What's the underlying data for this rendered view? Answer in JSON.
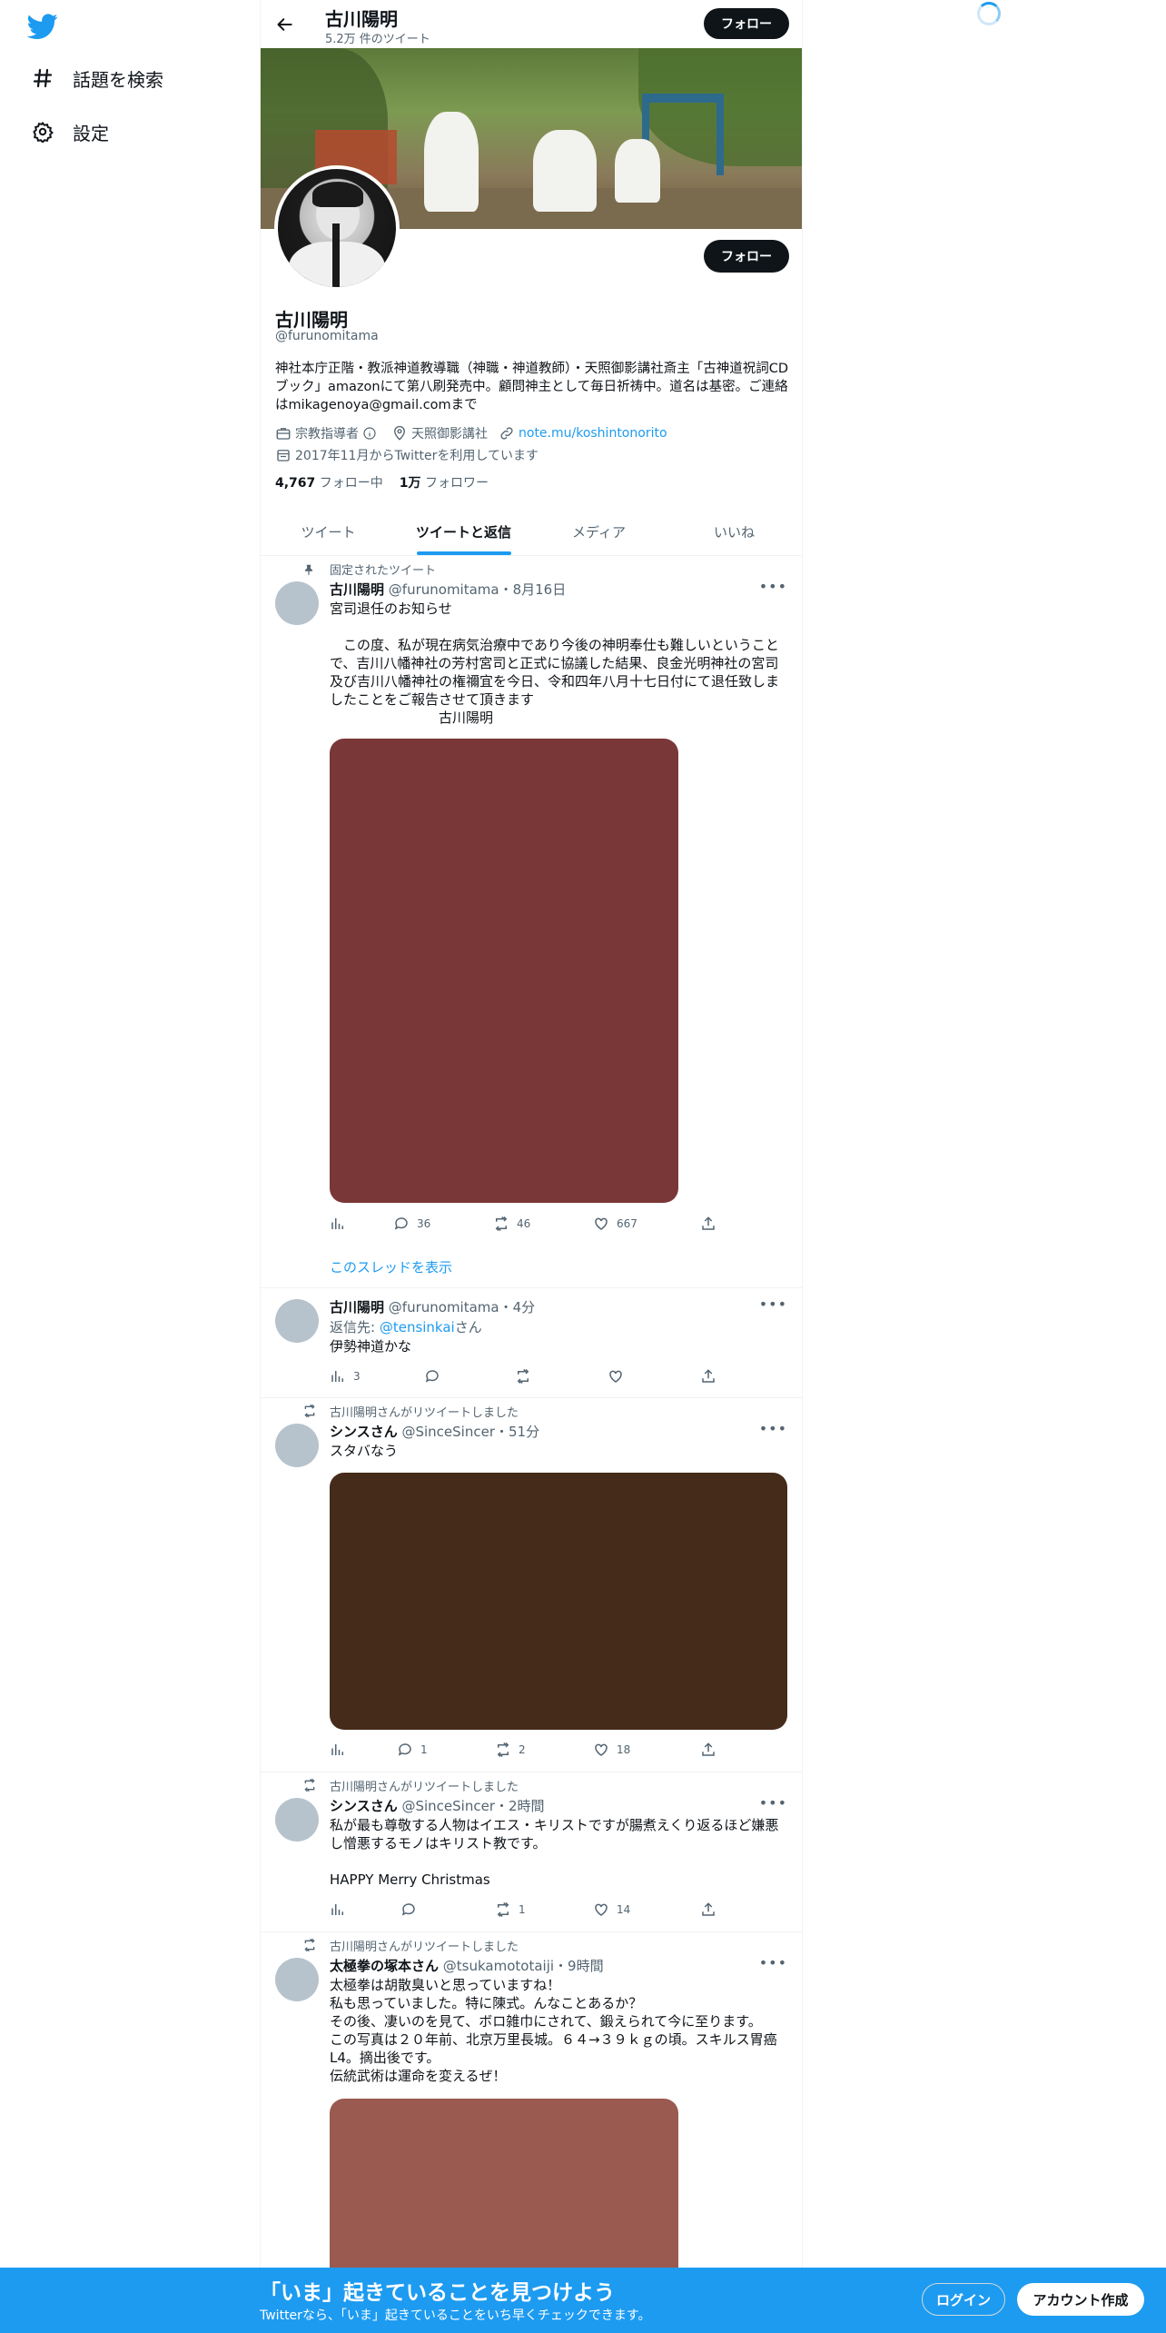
{
  "nav": {
    "explore_label": "話題を検索",
    "settings_label": "設定"
  },
  "header": {
    "name": "古川陽明",
    "tweet_count": "5.2万 件のツイート",
    "follow_label": "フォロー"
  },
  "profile": {
    "name": "古川陽明",
    "handle": "@furunomitama",
    "follow_label": "フォロー",
    "bio": "神社本庁正階・教派神道教導職（神職・神道教師）・天照御影講社斎主「古神道祝詞CDブック」amazonにて第八刷発売中。顧問神主として毎日祈祷中。道名は基密。ご連絡はmikagenoya@gmail.comまで",
    "category": "宗教指導者",
    "location": "天照御影講社",
    "url": "note.mu/koshintonorito",
    "joined": "2017年11月からTwitterを利用しています",
    "following_count": "4,767",
    "following_label": "フォロー中",
    "followers_count": "1万",
    "followers_label": "フォロワー"
  },
  "tabs": [
    {
      "label": "ツイート"
    },
    {
      "label": "ツイートと返信"
    },
    {
      "label": "メディア"
    },
    {
      "label": "いいね"
    }
  ],
  "tweets": [
    {
      "context": "固定されたツイート",
      "name": "古川陽明",
      "meta": "@furunomitama・8月16日",
      "text": "宮司退任のお知らせ\n\n　この度、私が現在病気治療中であり今後の神明奉仕も難しいということで、吉川八幡神社の芳村宮司と正式に協議した結果、良金光明神社の宮司及び吉川八幡神社の権禰宜を今日、令和四年八月十七日付にて退任致しましたことをご報告させて頂きます\n　　　　　　　　古川陽明",
      "image_color": "#7a3737",
      "views": "",
      "replies": "36",
      "retweets": "46",
      "likes": "667",
      "show_thread": "このスレッドを表示"
    },
    {
      "name": "古川陽明",
      "meta": "@furunomitama・4分",
      "reply_prefix": "返信先: ",
      "reply_to": "@tensinkai",
      "reply_suffix": "さん",
      "text": "伊勢神道かな",
      "views": "3",
      "replies": "",
      "retweets": "",
      "likes": ""
    },
    {
      "context": "古川陽明さんがリツイートしました",
      "name": "シンスさん",
      "meta": "@SinceSincer・51分",
      "text": "スタバなう",
      "image_color": "#452b1a",
      "views": "",
      "replies": "1",
      "retweets": "2",
      "likes": "18"
    },
    {
      "context": "古川陽明さんがリツイートしました",
      "name": "シンスさん",
      "meta": "@SinceSincer・2時間",
      "text": "私が最も尊敬する人物はイエス・キリストですが腸煮えくり返るほど嫌悪し憎悪するモノはキリスト教です。\n\nHAPPY Merry Christmas",
      "views": "",
      "replies": "",
      "retweets": "1",
      "likes": "14"
    },
    {
      "context": "古川陽明さんがリツイートしました",
      "name": "太極拳の塚本さん",
      "meta": "@tsukamototaiji・9時間",
      "text": "太極拳は胡散臭いと思っていますね！\n私も思っていました。特に陳式。んなことあるか？\nその後、凄いのを見て、ボロ雑巾にされて、鍛えられて今に至ります。\nこの写真は２０年前、北京万里長城。６４→３９ｋｇの頃。スキルス胃癌L4。摘出後です。\n伝統武術は運命を変えるぜ！",
      "image_color": "#9a5a50"
    }
  ],
  "bottombar": {
    "title": "「いま」起きていることを見つけよう",
    "subtitle": "Twitterなら、「いま」起きていることをいち早くチェックできます。",
    "login_label": "ログイン",
    "signup_label": "アカウント作成"
  },
  "colors": {
    "accent": "#1d9bf0",
    "text": "#0f1419",
    "muted": "#536471",
    "border": "#eff3f4"
  },
  "icons": [
    "twitter-bird-icon",
    "hashtag-icon",
    "gear-icon",
    "back-arrow-icon",
    "briefcase-icon",
    "info-icon",
    "location-pin-icon",
    "link-icon",
    "calendar-icon",
    "pin-icon",
    "retweet-icon",
    "more-icon",
    "views-icon",
    "reply-icon",
    "like-icon",
    "share-icon",
    "loading-spinner-icon"
  ]
}
